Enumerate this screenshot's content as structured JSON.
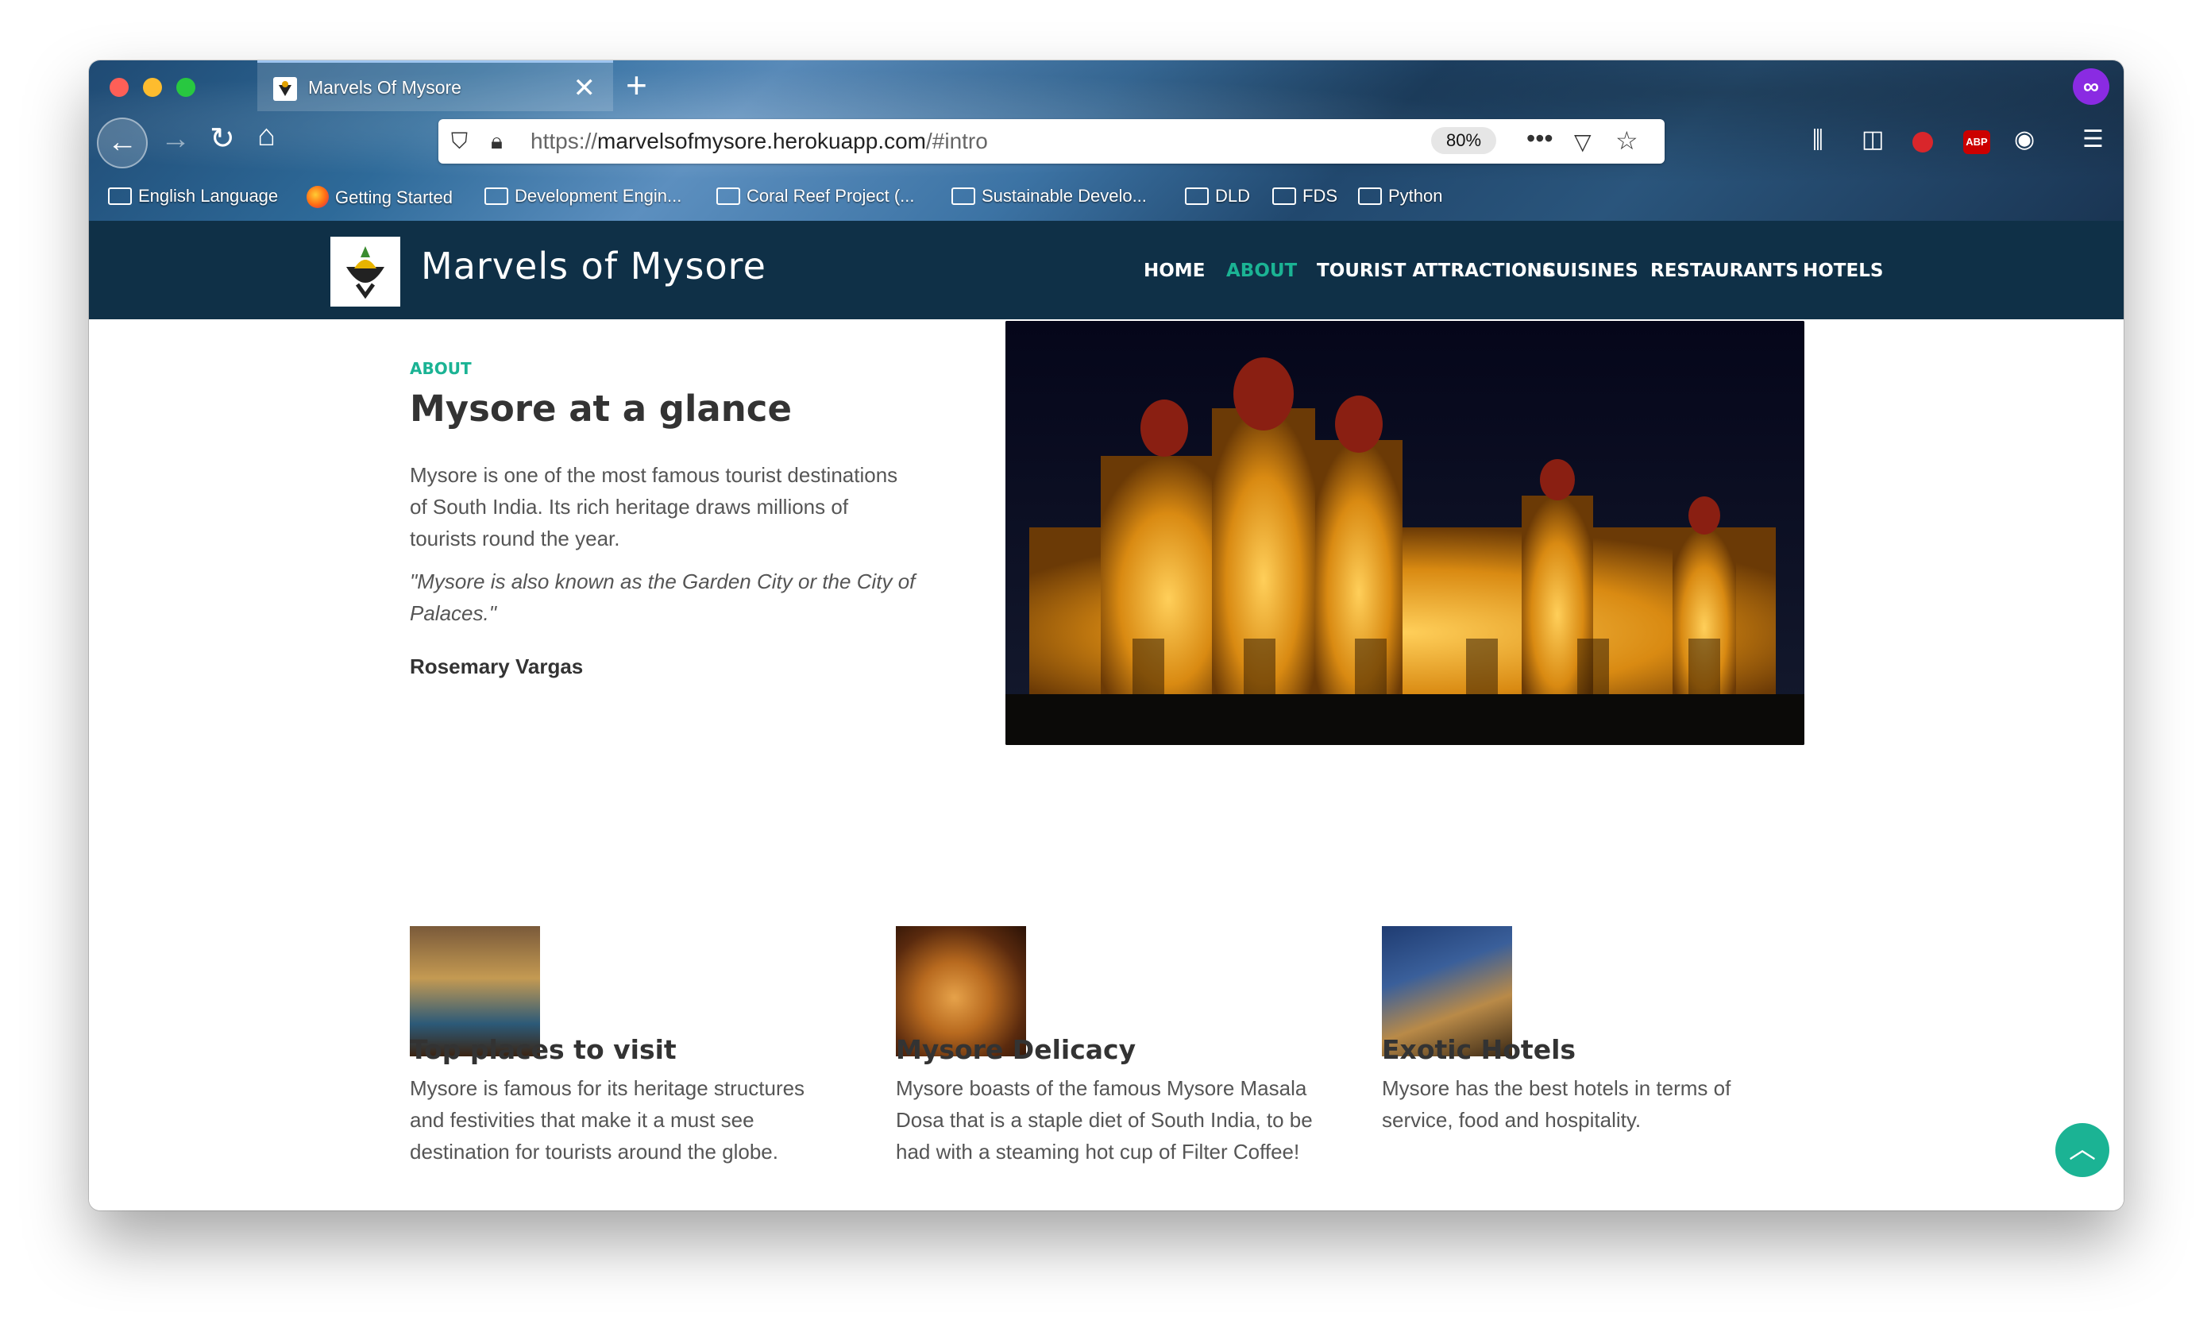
{
  "browser": {
    "tab_title": "Marvels Of Mysore",
    "new_tab": "+",
    "close_tab": "✕",
    "url_scheme": "https://",
    "url_host": "marvelsofmysore.herokuapp.com",
    "url_path": "/#intro",
    "zoom": "80%",
    "ext_abp": "ABP",
    "menu_icon": "☰",
    "bookmarks": [
      {
        "label": "English Language",
        "icon": "folder-icon"
      },
      {
        "label": "Getting Started",
        "icon": "firefox-icon"
      },
      {
        "label": "Development Engin...",
        "icon": "folder-icon"
      },
      {
        "label": "Coral Reef Project (...",
        "icon": "folder-icon"
      },
      {
        "label": "Sustainable Develo...",
        "icon": "folder-icon"
      },
      {
        "label": "DLD",
        "icon": "folder-icon"
      },
      {
        "label": "FDS",
        "icon": "folder-icon"
      },
      {
        "label": "Python",
        "icon": "folder-icon"
      }
    ]
  },
  "site": {
    "brand": "Marvels of Mysore",
    "nav": [
      "HOME",
      "ABOUT",
      "TOURIST ATTRACTIONS",
      "CUISINES",
      "RESTAURANTS",
      "HOTELS"
    ],
    "active_nav": "ABOUT",
    "accent_color": "#1bb394",
    "nav_bg": "#0f3047"
  },
  "about": {
    "kicker": "ABOUT",
    "title": "Mysore at a glance",
    "text": "Mysore is one of the most famous tourist destinations of South India. Its rich heritage draws millions of tourists round the year.",
    "quote": "\"Mysore is also known as the Garden City or the City of Palaces.\"",
    "author": "Rosemary Vargas"
  },
  "cards": [
    {
      "title": "Top places to visit",
      "text": "Mysore is famous for its heritage structures and festivities that make it a must see destination for tourists around the globe."
    },
    {
      "title": "Mysore Delicacy",
      "text": "Mysore boasts of the famous Mysore Masala Dosa that is a staple diet of South India, to be had with a steaming hot cup of Filter Coffee!"
    },
    {
      "title": "Exotic Hotels",
      "text": "Mysore has the best hotels in terms of service, food and hospitality."
    }
  ],
  "back_to_top": "︿"
}
